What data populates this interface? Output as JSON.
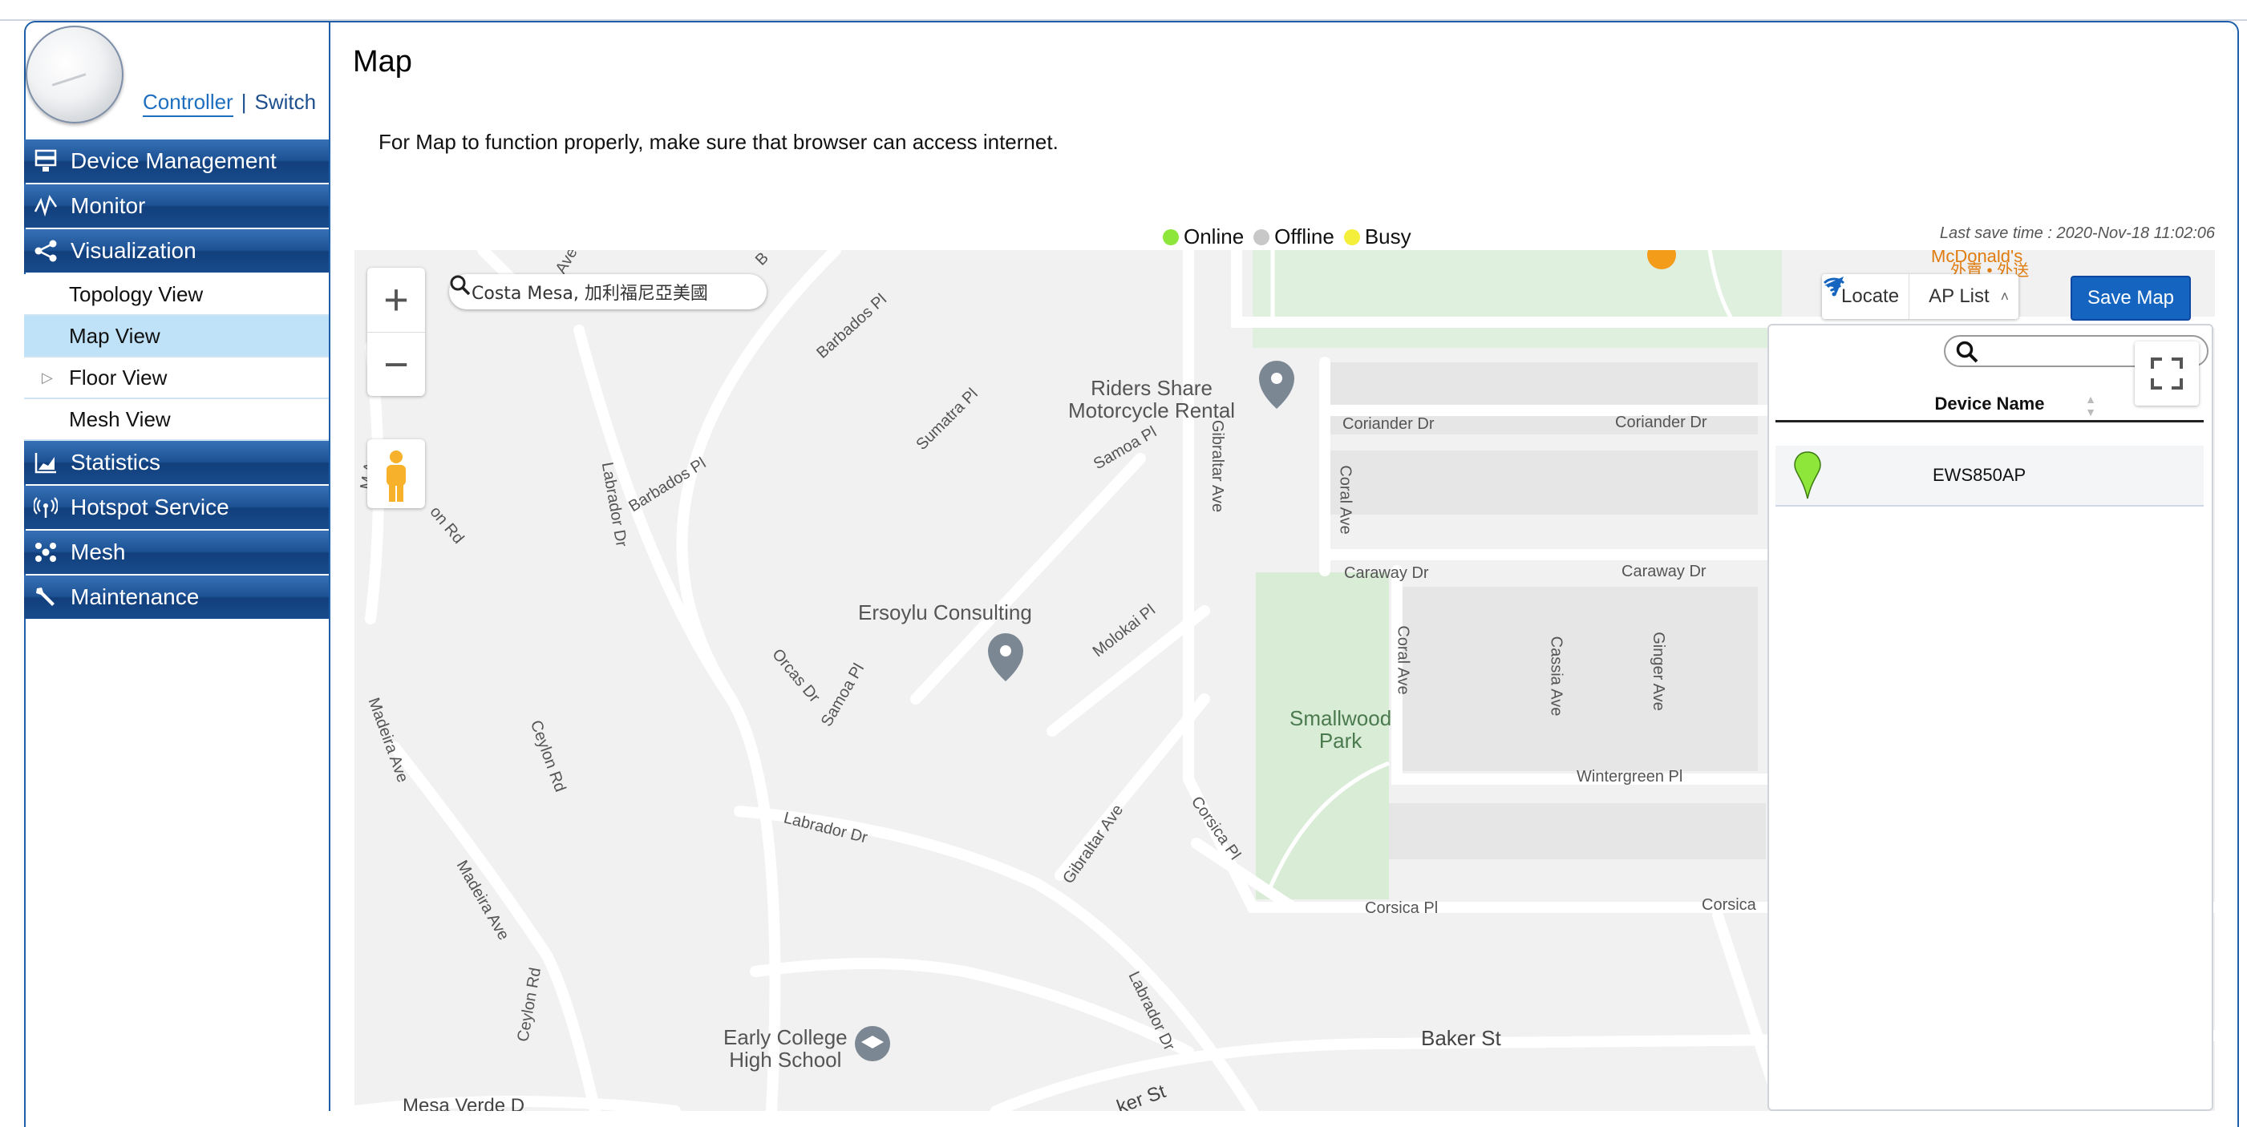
{
  "header": {
    "mode_controller": "Controller",
    "mode_separator": "|",
    "mode_switch": "Switch"
  },
  "sidebar": {
    "items": [
      {
        "label": "Device Management",
        "icon": "device-management-icon"
      },
      {
        "label": "Monitor",
        "icon": "monitor-icon"
      },
      {
        "label": "Visualization",
        "icon": "share-icon",
        "children": [
          {
            "label": "Topology View"
          },
          {
            "label": "Map View",
            "active": true
          },
          {
            "label": "Floor View",
            "expandable": true
          },
          {
            "label": "Mesh View"
          }
        ]
      },
      {
        "label": "Statistics",
        "icon": "statistics-icon"
      },
      {
        "label": "Hotspot Service",
        "icon": "hotspot-icon"
      },
      {
        "label": "Mesh",
        "icon": "mesh-icon"
      },
      {
        "label": "Maintenance",
        "icon": "wrench-icon"
      }
    ]
  },
  "page": {
    "title": "Map",
    "notice": "For Map to function properly, make sure that browser can access internet.",
    "legend": [
      {
        "label": "Online",
        "color": "#8ee63b"
      },
      {
        "label": "Offline",
        "color": "#c8c8c8"
      },
      {
        "label": "Busy",
        "color": "#f4ef3a"
      }
    ],
    "last_save": "Last save time : 2020-Nov-18 11:02:06"
  },
  "map": {
    "search_value": "Costa Mesa, 加利福尼亞美國",
    "zoom_in": "+",
    "zoom_out": "−",
    "toolbar": {
      "locate": "Locate",
      "ap_list": "AP List",
      "save": "Save Map"
    },
    "poi": {
      "riders": "Riders Share\nMotorcycle Rental",
      "ersoylu": "Ersoylu Consulting",
      "park": "Smallwood\nPark",
      "school": "Early College\nHigh School",
      "mcdonalds": "McDonald's",
      "mcdonalds_sub": "外賣 • 外送"
    },
    "streets": {
      "barbados1": "Barbados Pl",
      "barbados2": "Barbados Pl",
      "sumatra": "Sumatra Pl",
      "samoa1": "Samoa Pl",
      "samoa2": "Samoa Pl",
      "gibraltar1": "Gibraltar Ave",
      "gibraltar2": "Gibraltar Ave",
      "labrador1": "Labrador Dr",
      "labrador2": "Labrador Dr",
      "labrador3": "Labrador Dr",
      "coriander1": "Coriander Dr",
      "coriander2": "Coriander Dr",
      "caraway1": "Caraway Dr",
      "caraway2": "Caraway Dr",
      "coral1": "Coral Ave",
      "coral2": "Coral Ave",
      "cassia": "Cassia Ave",
      "ginger": "Ginger Ave",
      "wintergreen": "Wintergreen Pl",
      "corsica1": "Corsica Pl",
      "corsica2": "Corsica Pl",
      "corsica3": "Corsica",
      "molokai": "Molokai Pl",
      "orcas": "Orcas Dr",
      "madeira1": "Madeira Ave",
      "madeira2": "Madeira Ave",
      "ceylon1": "Ceylon Rd",
      "ceylon2": "Ceylon Rd",
      "onrd": "on Rd",
      "baker": "Baker St",
      "mesaverde": "Mesa Verde D",
      "ker": "ker St",
      "mave": "M Ave",
      "ave_top": "Ave",
      "b_top": "B"
    },
    "ap_panel": {
      "column_header": "Device Name",
      "rows": [
        {
          "name": "EWS850AP",
          "status_color": "#8ee63b"
        }
      ]
    }
  }
}
